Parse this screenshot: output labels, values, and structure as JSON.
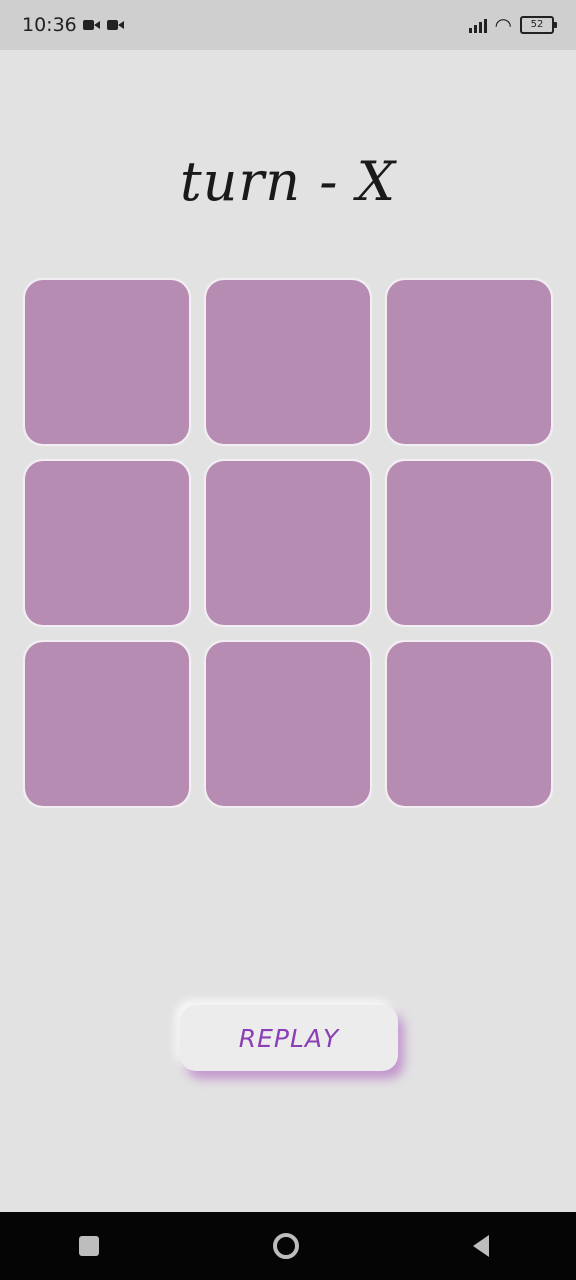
{
  "status_bar": {
    "time": "10:36",
    "battery": "52",
    "icons": [
      "video-camera-icon",
      "video-camera-icon",
      "signal-icon",
      "wifi-icon",
      "battery-icon"
    ]
  },
  "game": {
    "turn_text": "turn - X",
    "board": [
      "",
      "",
      "",
      "",
      "",
      "",
      "",
      "",
      ""
    ],
    "cell_color": "#b68cb3"
  },
  "replay": {
    "label": "REPLAY",
    "color": "#8a3fb5"
  },
  "nav": {
    "icons": [
      "recents-square-icon",
      "home-circle-icon",
      "back-triangle-icon"
    ]
  }
}
